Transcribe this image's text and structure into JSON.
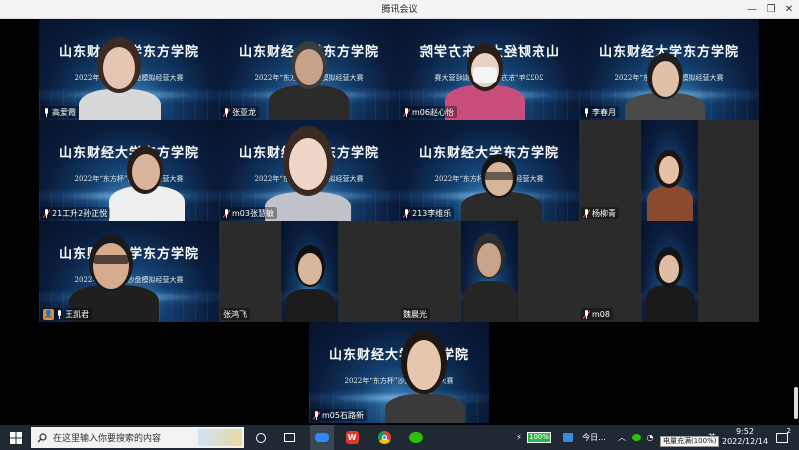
{
  "window": {
    "title": "腾讯会议",
    "controls": [
      "minimize",
      "restore",
      "close"
    ]
  },
  "banner": {
    "line1": "山东财经大学东方学院",
    "line2": "2022年“东方杯”沙盘模拟经营大赛"
  },
  "participants": [
    {
      "name": "高爱霞",
      "mic": "on"
    },
    {
      "name": "张亚龙",
      "mic": "muted"
    },
    {
      "name": "m06赵心怡",
      "mic": "muted"
    },
    {
      "name": "李春月",
      "mic": "on"
    },
    {
      "name": "21工升2孙正悦",
      "mic": "muted"
    },
    {
      "name": "m03张慧敏",
      "mic": "muted"
    },
    {
      "name": "213李维乐",
      "mic": "muted"
    },
    {
      "name": "杨柳青",
      "mic": "muted"
    },
    {
      "name": "王凯君",
      "mic": "on",
      "host": true
    },
    {
      "name": "张鸿飞",
      "mic": "none"
    },
    {
      "name": "魏晨光",
      "mic": "none"
    },
    {
      "name": "m08",
      "mic": "muted"
    },
    {
      "name": "m05石路新",
      "mic": "muted"
    }
  ],
  "taskbar": {
    "search_placeholder": "在这里输入你要搜索的内容",
    "battery_percent": "100%",
    "widget_label": "今日...",
    "ime": "英",
    "time": "9:52",
    "date": "2022/12/14",
    "notification_count": "2",
    "battery_tooltip": "电量充满(100%)"
  }
}
